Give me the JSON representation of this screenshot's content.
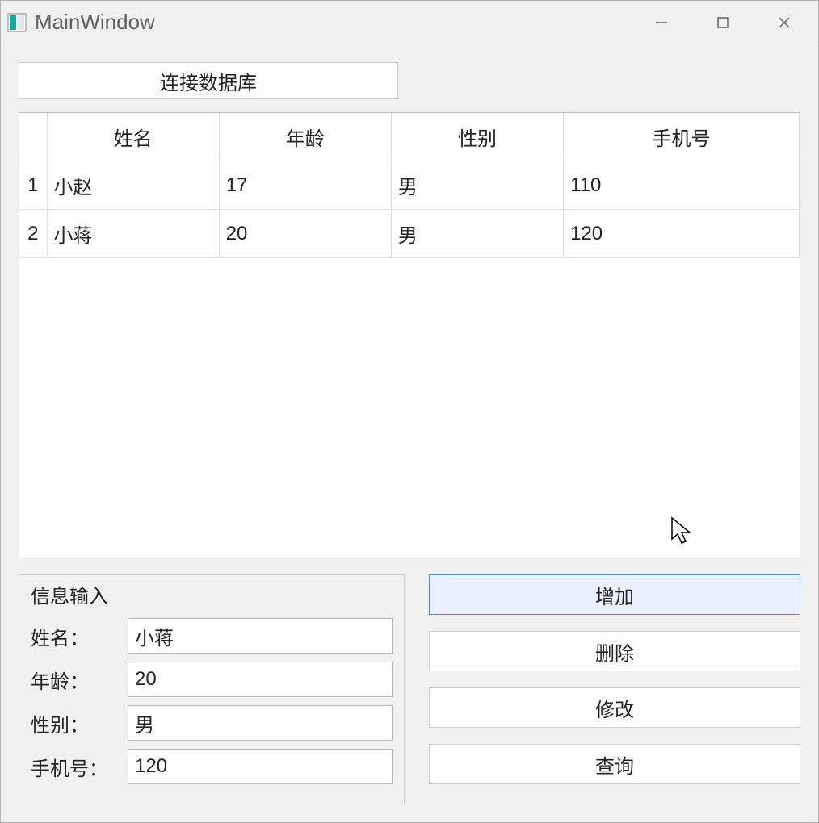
{
  "window": {
    "title": "MainWindow"
  },
  "toolbar": {
    "connect_label": "连接数据库"
  },
  "table": {
    "headers": [
      "姓名",
      "年龄",
      "性别",
      "手机号"
    ],
    "rows": [
      {
        "n": "1",
        "cells": [
          "小赵",
          "17",
          "男",
          "110"
        ]
      },
      {
        "n": "2",
        "cells": [
          "小蒋",
          "20",
          "男",
          "120"
        ]
      }
    ]
  },
  "form": {
    "group_title": "信息输入",
    "labels": {
      "name": "姓名：",
      "age": "年龄：",
      "gender": "性别：",
      "phone": "手机号："
    },
    "values": {
      "name": "小蒋",
      "age": "20",
      "gender": "男",
      "phone": "120"
    }
  },
  "actions": {
    "add": "增加",
    "delete": "删除",
    "update": "修改",
    "query": "查询"
  }
}
